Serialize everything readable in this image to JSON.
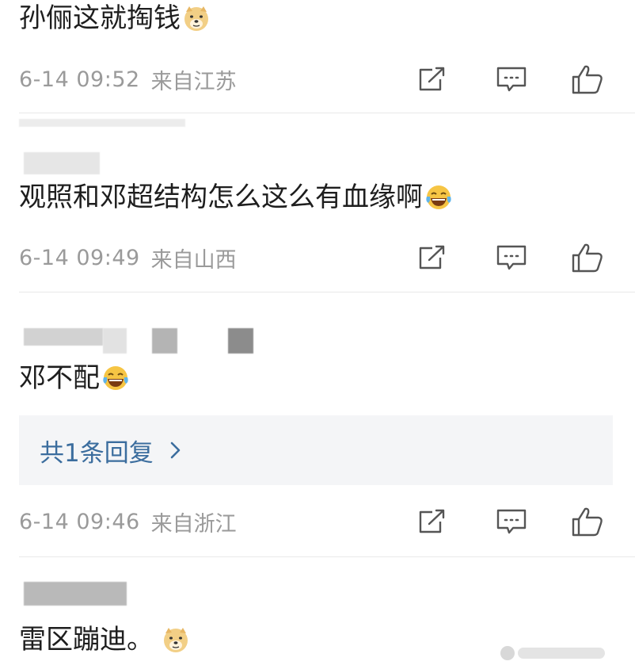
{
  "comments": [
    {
      "text": "孙俪这就掏钱",
      "emoji": "doge-emoji",
      "time": "6-14 09:52",
      "location": "来自江苏"
    },
    {
      "text": "观照和邓超结构怎么这么有血缘啊",
      "emoji": "laugh-cry-emoji",
      "time": "6-14 09:49",
      "location": "来自山西"
    },
    {
      "text": "邓不配",
      "emoji": "laugh-cry-emoji",
      "reply_label": "共1条回复",
      "time": "6-14 09:46",
      "location": "来自浙江"
    },
    {
      "text": "雷区蹦迪。",
      "emoji": "doge-emoji"
    }
  ],
  "icons": {
    "share": "share-icon",
    "comment": "comment-icon",
    "like": "thumbs-up-icon"
  },
  "colors": {
    "text": "#1e1e1e",
    "meta": "#9a9a9a",
    "reply_link": "#3b6d9e",
    "reply_bg": "#f4f5f7",
    "divider": "#e9e9e9"
  }
}
